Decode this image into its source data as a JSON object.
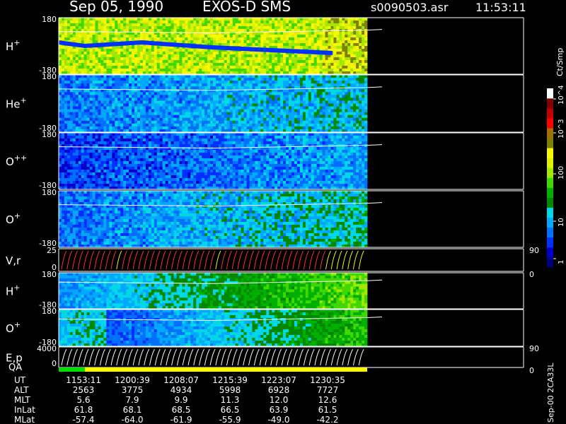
{
  "header": {
    "date": "Sep 05, 1990",
    "instrument": "EXOS-D SMS",
    "file": "s0090503.asr",
    "time": "11:53:11"
  },
  "panels": [
    {
      "label": "H",
      "sup": "+",
      "top": "180",
      "bottom": "-180"
    },
    {
      "label": "He",
      "sup": "+",
      "top": "180",
      "bottom": "-180"
    },
    {
      "label": "O",
      "sup": "++",
      "top": "180",
      "bottom": "-180"
    },
    {
      "label": "O",
      "sup": "+",
      "top": "180",
      "bottom": "-180"
    },
    {
      "label": "V,r",
      "sup": "",
      "top": "25",
      "bottom": "0",
      "right_top": "90",
      "right_bottom": "0"
    },
    {
      "label": "H",
      "sup": "+",
      "top": "180",
      "bottom": "-180"
    },
    {
      "label": "O",
      "sup": "+",
      "top": "180",
      "bottom": "-180"
    },
    {
      "label": "E,p",
      "sup": "",
      "top": "4000",
      "bottom": "0",
      "right_top": "90",
      "right_bottom": "0"
    }
  ],
  "qa_label": "QA",
  "colorbar": {
    "unit": "Ct/Smp",
    "labels": [
      "1",
      "10",
      "100",
      "10^3",
      "10^4"
    ],
    "colors": [
      "#00007f",
      "#0000c8",
      "#0030ff",
      "#0070ff",
      "#00a8ff",
      "#00d8e8",
      "#008800",
      "#00b000",
      "#40d800",
      "#a0e800",
      "#e0f000",
      "#f8f800",
      "#808000",
      "#a07000",
      "#ff0000",
      "#c00000",
      "#800000",
      "#ffffff"
    ]
  },
  "footer_id": "Sep-00 2CA33L",
  "ephemeris": {
    "rows": [
      {
        "label": "UT",
        "values": [
          "1153:11",
          "1200:39",
          "1208:07",
          "1215:39",
          "1223:07",
          "1230:35"
        ]
      },
      {
        "label": "ALT",
        "values": [
          "2563",
          "3775",
          "4934",
          "5998",
          "6928",
          "7727"
        ]
      },
      {
        "label": "MLT",
        "values": [
          "5.6",
          "7.9",
          "9.9",
          "11.3",
          "12.0",
          "12.6"
        ]
      },
      {
        "label": "InLat",
        "values": [
          "61.8",
          "68.1",
          "68.5",
          "66.5",
          "63.9",
          "61.5"
        ]
      },
      {
        "label": "MLat",
        "values": [
          "-57.4",
          "-64.0",
          "-61.9",
          "-55.9",
          "-49.0",
          "-42.2"
        ]
      }
    ]
  },
  "chart_data": {
    "type": "heatmap",
    "x_ticks_ut": [
      "1153:11",
      "1200:39",
      "1208:07",
      "1215:39",
      "1223:07",
      "1230:35"
    ],
    "panels_y_range": [
      [
        -180,
        180
      ],
      [
        -180,
        180
      ],
      [
        -180,
        180
      ],
      [
        -180,
        180
      ],
      [
        0,
        25
      ],
      [
        -180,
        180
      ],
      [
        -180,
        180
      ],
      [
        0,
        4000
      ]
    ],
    "color_scale": "log",
    "color_range": [
      1,
      10000
    ]
  }
}
